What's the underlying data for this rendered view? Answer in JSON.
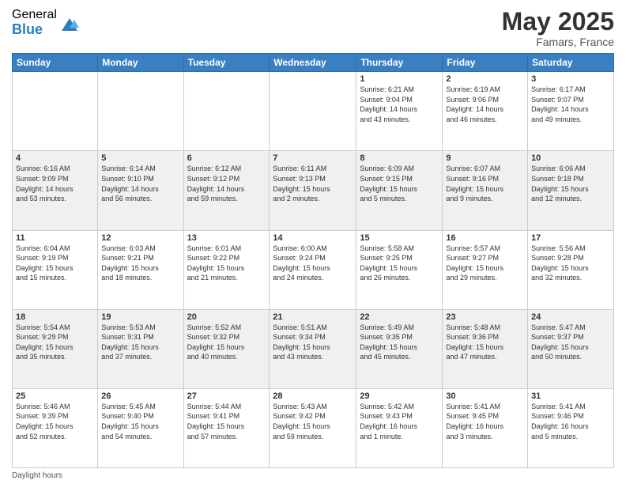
{
  "logo": {
    "general": "General",
    "blue": "Blue"
  },
  "title": "May 2025",
  "location": "Famars, France",
  "days_header": [
    "Sunday",
    "Monday",
    "Tuesday",
    "Wednesday",
    "Thursday",
    "Friday",
    "Saturday"
  ],
  "weeks": [
    [
      {
        "num": "",
        "info": ""
      },
      {
        "num": "",
        "info": ""
      },
      {
        "num": "",
        "info": ""
      },
      {
        "num": "",
        "info": ""
      },
      {
        "num": "1",
        "info": "Sunrise: 6:21 AM\nSunset: 9:04 PM\nDaylight: 14 hours\nand 43 minutes."
      },
      {
        "num": "2",
        "info": "Sunrise: 6:19 AM\nSunset: 9:06 PM\nDaylight: 14 hours\nand 46 minutes."
      },
      {
        "num": "3",
        "info": "Sunrise: 6:17 AM\nSunset: 9:07 PM\nDaylight: 14 hours\nand 49 minutes."
      }
    ],
    [
      {
        "num": "4",
        "info": "Sunrise: 6:16 AM\nSunset: 9:09 PM\nDaylight: 14 hours\nand 53 minutes."
      },
      {
        "num": "5",
        "info": "Sunrise: 6:14 AM\nSunset: 9:10 PM\nDaylight: 14 hours\nand 56 minutes."
      },
      {
        "num": "6",
        "info": "Sunrise: 6:12 AM\nSunset: 9:12 PM\nDaylight: 14 hours\nand 59 minutes."
      },
      {
        "num": "7",
        "info": "Sunrise: 6:11 AM\nSunset: 9:13 PM\nDaylight: 15 hours\nand 2 minutes."
      },
      {
        "num": "8",
        "info": "Sunrise: 6:09 AM\nSunset: 9:15 PM\nDaylight: 15 hours\nand 5 minutes."
      },
      {
        "num": "9",
        "info": "Sunrise: 6:07 AM\nSunset: 9:16 PM\nDaylight: 15 hours\nand 9 minutes."
      },
      {
        "num": "10",
        "info": "Sunrise: 6:06 AM\nSunset: 9:18 PM\nDaylight: 15 hours\nand 12 minutes."
      }
    ],
    [
      {
        "num": "11",
        "info": "Sunrise: 6:04 AM\nSunset: 9:19 PM\nDaylight: 15 hours\nand 15 minutes."
      },
      {
        "num": "12",
        "info": "Sunrise: 6:03 AM\nSunset: 9:21 PM\nDaylight: 15 hours\nand 18 minutes."
      },
      {
        "num": "13",
        "info": "Sunrise: 6:01 AM\nSunset: 9:22 PM\nDaylight: 15 hours\nand 21 minutes."
      },
      {
        "num": "14",
        "info": "Sunrise: 6:00 AM\nSunset: 9:24 PM\nDaylight: 15 hours\nand 24 minutes."
      },
      {
        "num": "15",
        "info": "Sunrise: 5:58 AM\nSunset: 9:25 PM\nDaylight: 15 hours\nand 26 minutes."
      },
      {
        "num": "16",
        "info": "Sunrise: 5:57 AM\nSunset: 9:27 PM\nDaylight: 15 hours\nand 29 minutes."
      },
      {
        "num": "17",
        "info": "Sunrise: 5:56 AM\nSunset: 9:28 PM\nDaylight: 15 hours\nand 32 minutes."
      }
    ],
    [
      {
        "num": "18",
        "info": "Sunrise: 5:54 AM\nSunset: 9:29 PM\nDaylight: 15 hours\nand 35 minutes."
      },
      {
        "num": "19",
        "info": "Sunrise: 5:53 AM\nSunset: 9:31 PM\nDaylight: 15 hours\nand 37 minutes."
      },
      {
        "num": "20",
        "info": "Sunrise: 5:52 AM\nSunset: 9:32 PM\nDaylight: 15 hours\nand 40 minutes."
      },
      {
        "num": "21",
        "info": "Sunrise: 5:51 AM\nSunset: 9:34 PM\nDaylight: 15 hours\nand 43 minutes."
      },
      {
        "num": "22",
        "info": "Sunrise: 5:49 AM\nSunset: 9:35 PM\nDaylight: 15 hours\nand 45 minutes."
      },
      {
        "num": "23",
        "info": "Sunrise: 5:48 AM\nSunset: 9:36 PM\nDaylight: 15 hours\nand 47 minutes."
      },
      {
        "num": "24",
        "info": "Sunrise: 5:47 AM\nSunset: 9:37 PM\nDaylight: 15 hours\nand 50 minutes."
      }
    ],
    [
      {
        "num": "25",
        "info": "Sunrise: 5:46 AM\nSunset: 9:39 PM\nDaylight: 15 hours\nand 52 minutes."
      },
      {
        "num": "26",
        "info": "Sunrise: 5:45 AM\nSunset: 9:40 PM\nDaylight: 15 hours\nand 54 minutes."
      },
      {
        "num": "27",
        "info": "Sunrise: 5:44 AM\nSunset: 9:41 PM\nDaylight: 15 hours\nand 57 minutes."
      },
      {
        "num": "28",
        "info": "Sunrise: 5:43 AM\nSunset: 9:42 PM\nDaylight: 15 hours\nand 59 minutes."
      },
      {
        "num": "29",
        "info": "Sunrise: 5:42 AM\nSunset: 9:43 PM\nDaylight: 16 hours\nand 1 minute."
      },
      {
        "num": "30",
        "info": "Sunrise: 5:41 AM\nSunset: 9:45 PM\nDaylight: 16 hours\nand 3 minutes."
      },
      {
        "num": "31",
        "info": "Sunrise: 5:41 AM\nSunset: 9:46 PM\nDaylight: 16 hours\nand 5 minutes."
      }
    ]
  ],
  "footer": "Daylight hours"
}
